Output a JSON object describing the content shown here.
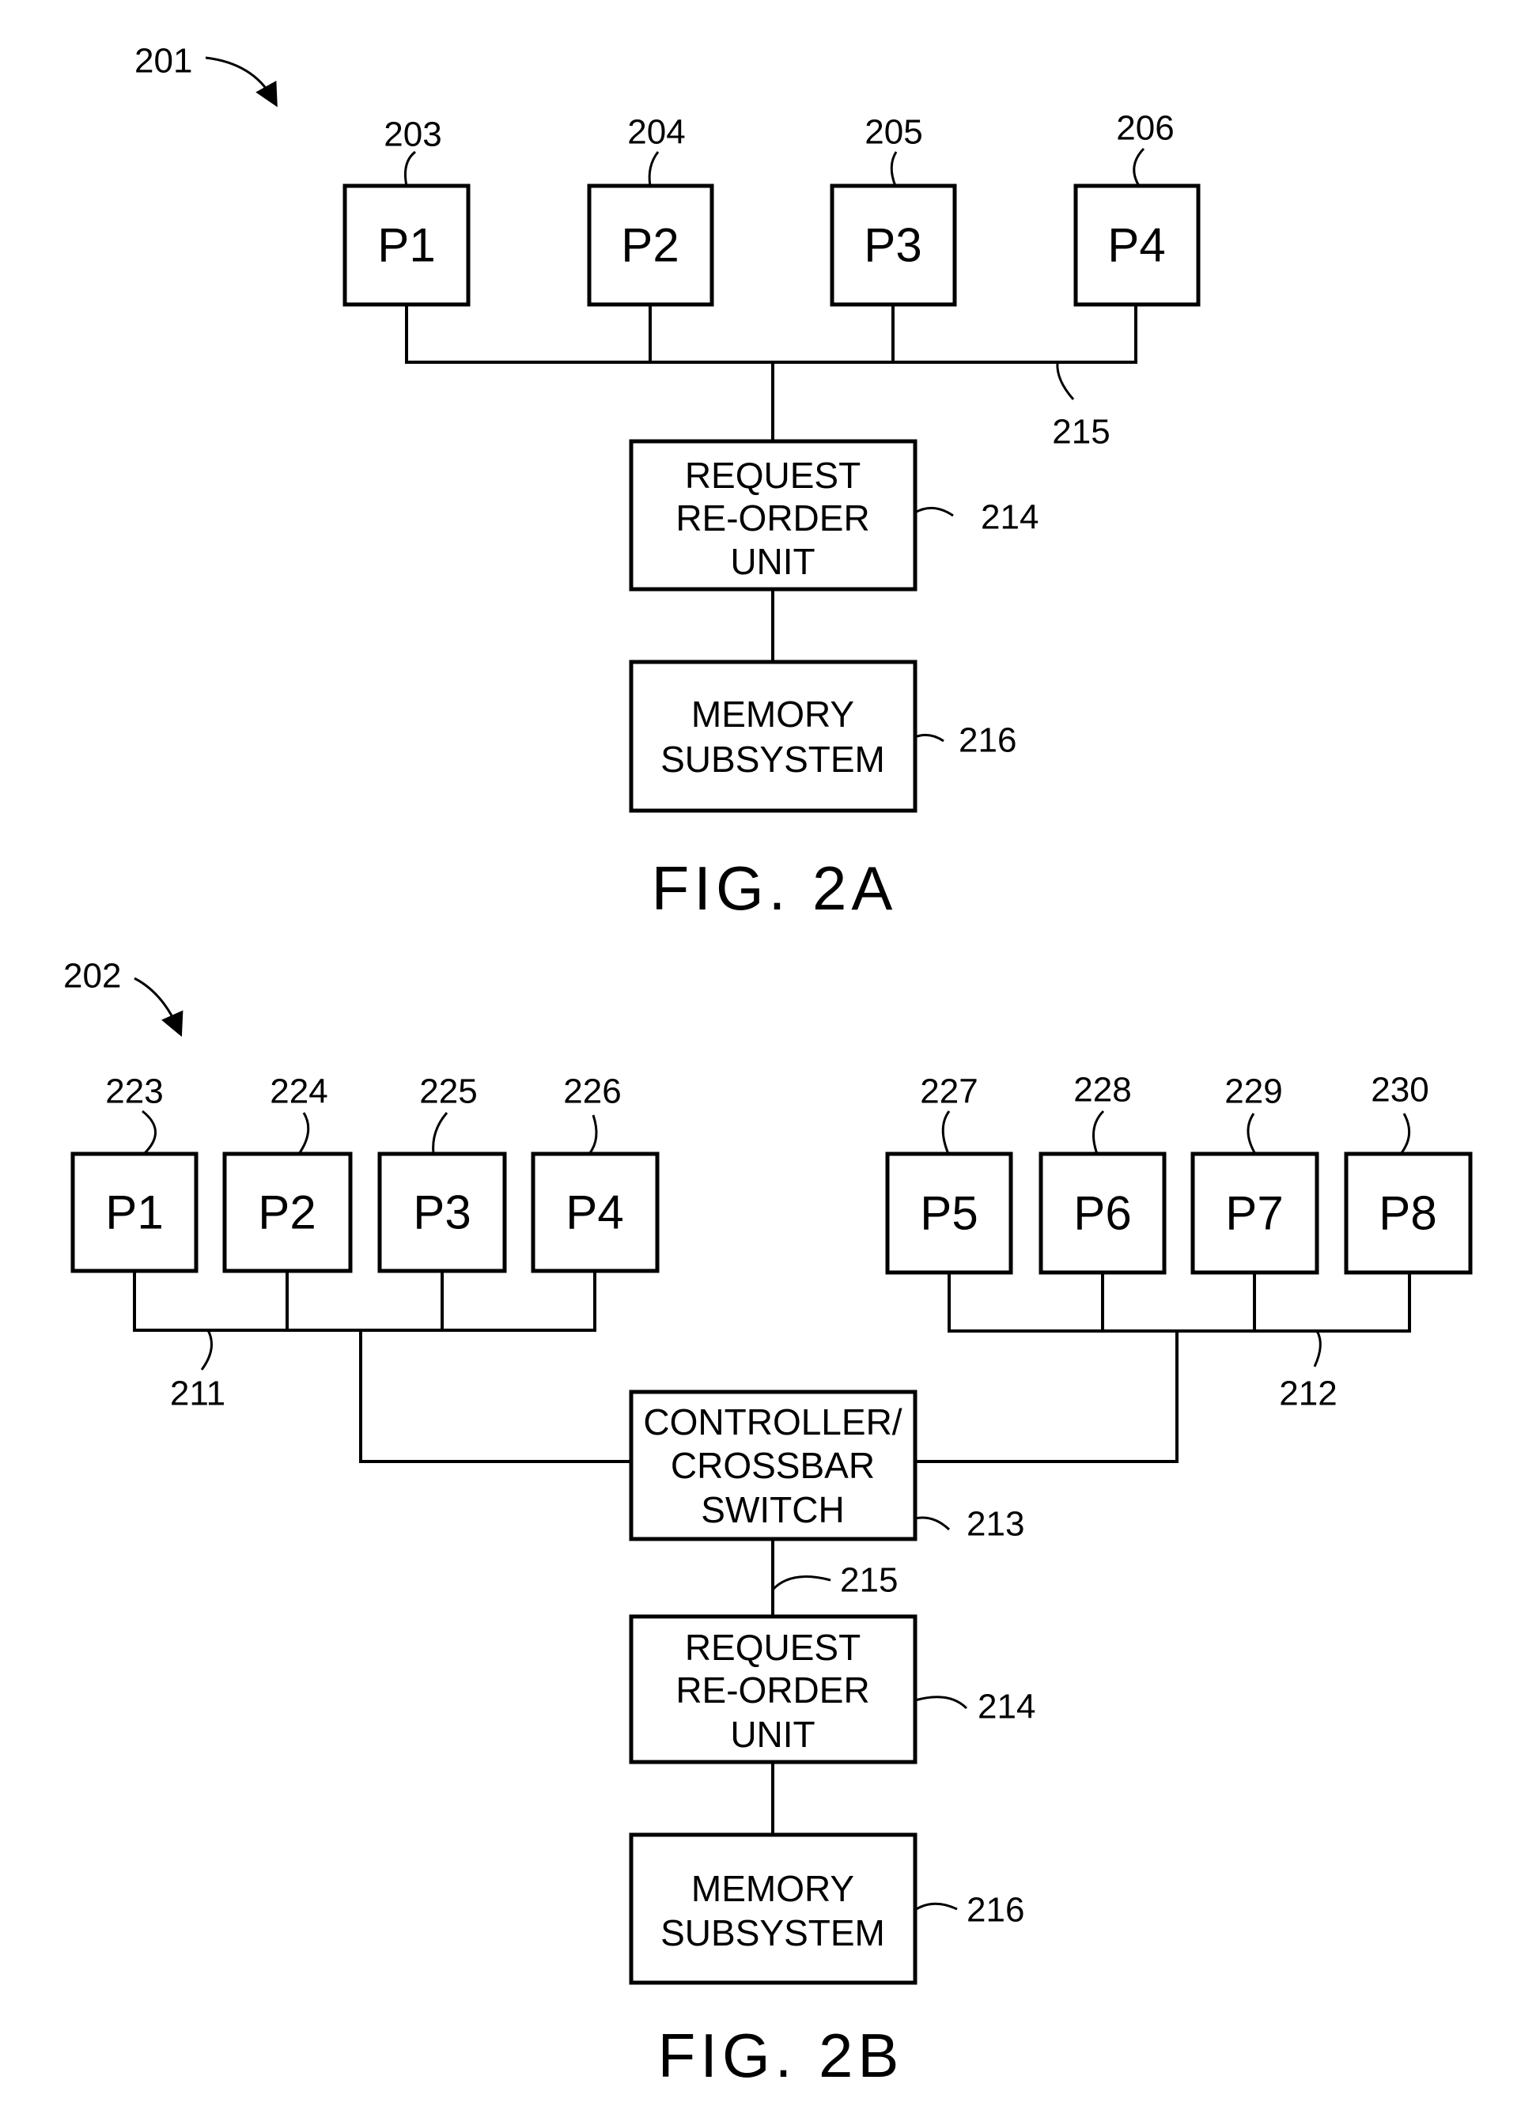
{
  "fig2a": {
    "ref": "201",
    "processors": [
      {
        "label": "P1",
        "ref": "203"
      },
      {
        "label": "P2",
        "ref": "204"
      },
      {
        "label": "P3",
        "ref": "205"
      },
      {
        "label": "P4",
        "ref": "206"
      }
    ],
    "bus_ref": "215",
    "reorder_unit": {
      "lines": [
        "REQUEST",
        "RE-ORDER",
        "UNIT"
      ],
      "ref": "214"
    },
    "memory": {
      "lines": [
        "MEMORY",
        "SUBSYSTEM"
      ],
      "ref": "216"
    },
    "caption": "FIG. 2A"
  },
  "fig2b": {
    "ref": "202",
    "processors_left": [
      {
        "label": "P1",
        "ref": "223"
      },
      {
        "label": "P2",
        "ref": "224"
      },
      {
        "label": "P3",
        "ref": "225"
      },
      {
        "label": "P4",
        "ref": "226"
      }
    ],
    "processors_right": [
      {
        "label": "P5",
        "ref": "227"
      },
      {
        "label": "P6",
        "ref": "228"
      },
      {
        "label": "P7",
        "ref": "229"
      },
      {
        "label": "P8",
        "ref": "230"
      }
    ],
    "left_bus_ref": "211",
    "right_bus_ref": "212",
    "switch": {
      "lines": [
        "CONTROLLER/",
        "CROSSBAR",
        "SWITCH"
      ],
      "ref": "213"
    },
    "link_ref": "215",
    "reorder_unit": {
      "lines": [
        "REQUEST",
        "RE-ORDER",
        "UNIT"
      ],
      "ref": "214"
    },
    "memory": {
      "lines": [
        "MEMORY",
        "SUBSYSTEM"
      ],
      "ref": "216"
    },
    "caption": "FIG. 2B"
  }
}
